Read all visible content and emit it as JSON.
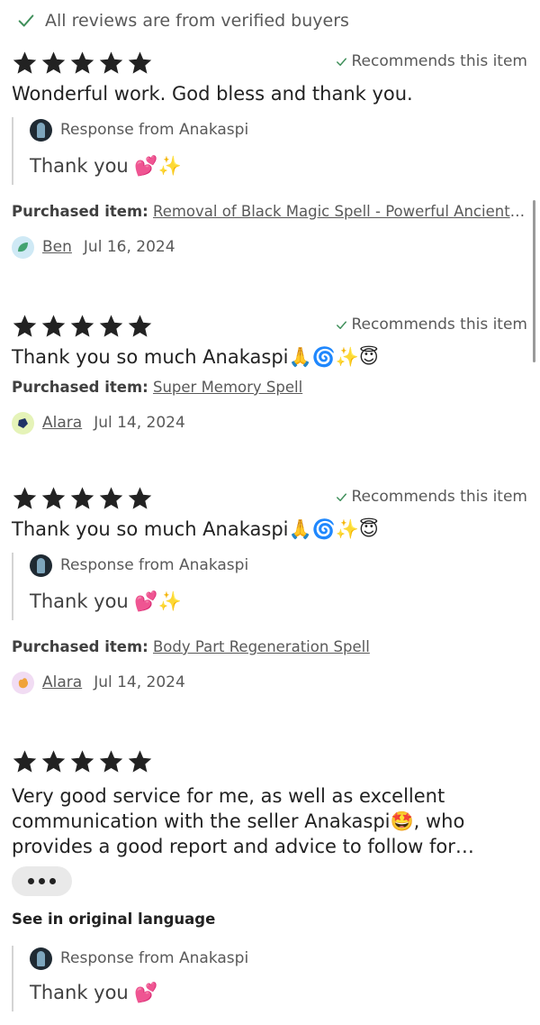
{
  "verified_banner": {
    "text": "All reviews are from verified buyers"
  },
  "recommends_label": "Recommends this item",
  "purchased_label": "Purchased item:",
  "response_label": "Response from Anakaspi",
  "colors": {
    "star": "#222222",
    "check": "#3f8f5a",
    "muted_text": "#595959",
    "divider": "#d4d4d4"
  },
  "reviews": [
    {
      "rating": 5,
      "recommends": true,
      "text": "Wonderful work. God bless and thank you.",
      "response": {
        "text": "Thank you 💕✨"
      },
      "purchased_item": "Removal of Black Magic Spell - Powerful Ancient Ritual",
      "reviewer": {
        "name": "Ben",
        "date": "Jul 16, 2024",
        "avatar_icon": "green-leaf-icon"
      }
    },
    {
      "rating": 5,
      "recommends": true,
      "text": "Thank you so much Anakaspi🙏🌀✨😇",
      "purchased_item": "Super Memory Spell",
      "reviewer": {
        "name": "Alara",
        "date": "Jul 14, 2024",
        "avatar_icon": "navy-gem-icon"
      }
    },
    {
      "rating": 5,
      "recommends": true,
      "text": "Thank you so much Anakaspi🙏🌀✨😇",
      "response": {
        "text": "Thank you 💕✨"
      },
      "purchased_item": "Body Part Regeneration Spell",
      "reviewer": {
        "name": "Alara",
        "date": "Jul 14, 2024",
        "avatar_icon": "orange-blob-icon"
      }
    },
    {
      "rating": 5,
      "recommends": false,
      "text": "Very good service for me, as well as excellent communication with the seller Anakaspi🤩, who provides a good report and advice to follow for…",
      "more_icon": "more-dots-icon",
      "see_original": "See in original language",
      "response": {
        "text": "Thank you 💕"
      }
    }
  ]
}
